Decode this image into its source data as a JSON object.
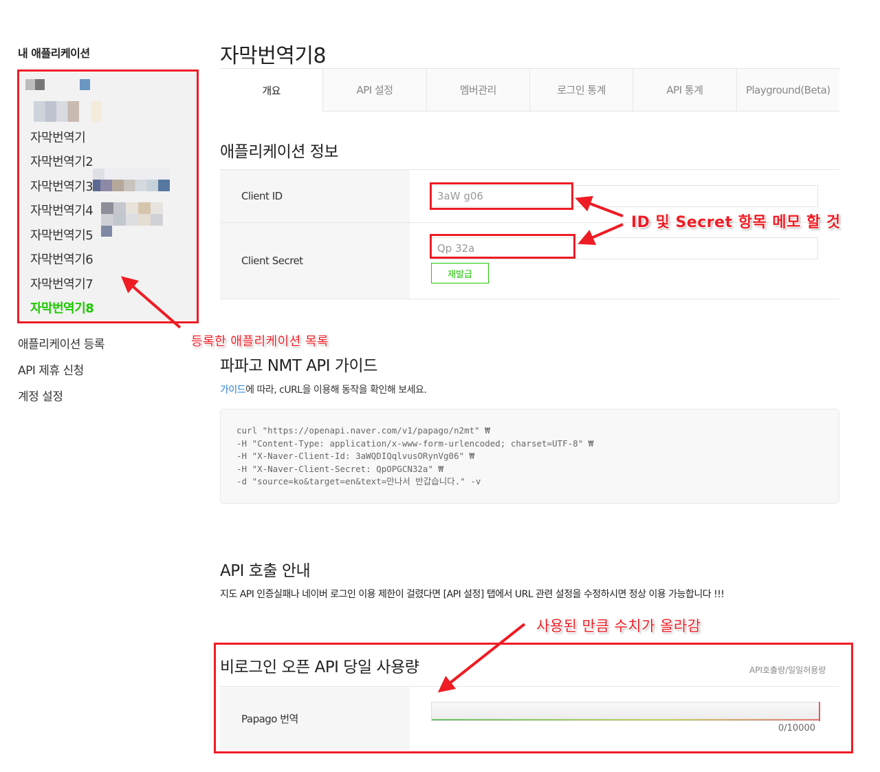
{
  "sidebar": {
    "title": "내 애플리케이션",
    "apps": [
      "자막번역기",
      "자막번역기2",
      "자막번역기3",
      "자막번역기4",
      "자막번역기5",
      "자막번역기6",
      "자막번역기7",
      "자막번역기8"
    ],
    "links": [
      "애플리케이션 등록",
      "API 제휴 신청",
      "계정 설정"
    ]
  },
  "app": {
    "title": "자막번역기8"
  },
  "tabs": [
    "개요",
    "API 설정",
    "멤버관리",
    "로그인 통계",
    "API 통계",
    "Playground(Beta)"
  ],
  "info": {
    "title": "애플리케이션 정보",
    "client_id_label": "Client ID",
    "client_id_value": "3aW                      g06",
    "client_secret_label": "Client Secret",
    "client_secret_value": "Qp              32a",
    "reissue_button": "재발급"
  },
  "guide": {
    "title": "파파고 NMT API 가이드",
    "link": "가이드",
    "text": "에 따라, cURL을 이용해 동작을 확인해 보세요.",
    "code": [
      "curl \"https://openapi.naver.com/v1/papago/n2mt\" ₩",
      "-H \"Content-Type: application/x-www-form-urlencoded; charset=UTF-8\" ₩",
      "-H \"X-Naver-Client-Id: 3aWQDIQqlvusORynVg06\" ₩",
      "-H \"X-Naver-Client-Secret: QpOPGCN32a\" ₩",
      "-d \"source=ko&target=en&text=만나서 반갑습니다.\" -v"
    ]
  },
  "api_call": {
    "title": "API 호출 안내",
    "note": "지도 API 인증실패나 네이버 로그인 이용 제한이 걸렸다면 [API 설정] 탭에서 URL 관련 설정을 수정하시면 정상 이용 가능합니다 !!!"
  },
  "usage": {
    "title": "비로그인 오픈 API 당일 사용량",
    "right_label": "API호출량/일일허용량",
    "row_label": "Papago 번역",
    "count": "0/10000",
    "used_fraction": 0
  },
  "annotations": {
    "id_secret": "ID 및 Secret 항목 메모 할 것",
    "app_list": "등록한 애플리케이션 목록",
    "usage_up": "사용된 만큼 수치가 올라감",
    "color": "#ee1c24"
  }
}
